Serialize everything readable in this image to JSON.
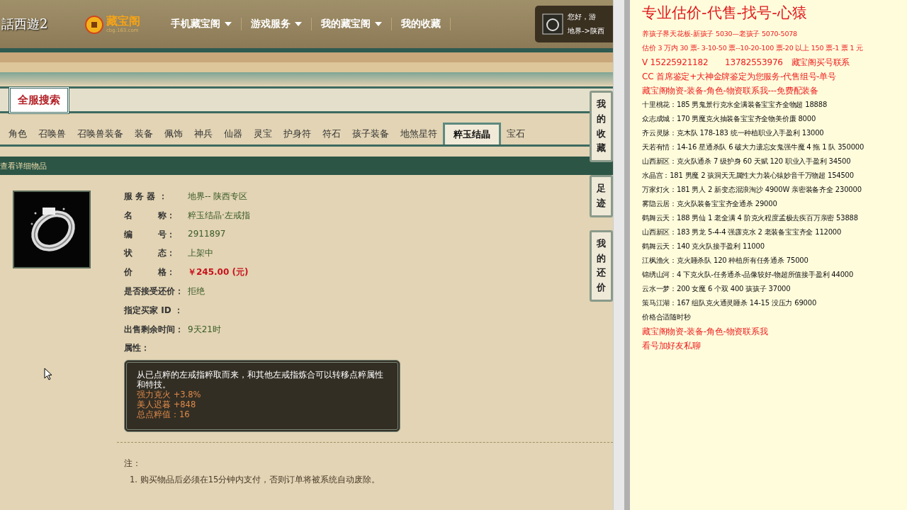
{
  "header": {
    "logo": "話西遊2",
    "brand": "藏宝阁",
    "brand_sub": "cbg.163.com",
    "nav": [
      {
        "label": "手机藏宝阁",
        "dropdown": true
      },
      {
        "label": "游戏服务",
        "dropdown": true
      },
      {
        "label": "我的藏宝阁",
        "dropdown": true
      },
      {
        "label": "我的收藏",
        "dropdown": false
      }
    ],
    "user": {
      "greeting": "您好，游",
      "server": "地界->陕西"
    }
  },
  "search_banner": "全服搜索",
  "tabs": [
    {
      "label": "角色",
      "selected": false
    },
    {
      "label": "召唤兽",
      "selected": false
    },
    {
      "label": "召唤兽装备",
      "selected": false
    },
    {
      "label": "装备",
      "selected": false
    },
    {
      "label": "佩饰",
      "selected": false
    },
    {
      "label": "神兵",
      "selected": false
    },
    {
      "label": "仙器",
      "selected": false
    },
    {
      "label": "灵宝",
      "selected": false
    },
    {
      "label": "护身符",
      "selected": false
    },
    {
      "label": "符石",
      "selected": false
    },
    {
      "label": "孩子装备",
      "selected": false
    },
    {
      "label": "地煞星符",
      "selected": false
    },
    {
      "label": "粹玉结晶",
      "selected": true
    },
    {
      "label": "宝石",
      "selected": false
    }
  ],
  "section_title": "查看详细物品",
  "item": {
    "fields": [
      {
        "label": "服 务 器 ：",
        "value": "地界-- 陕西专区",
        "kind": "normal"
      },
      {
        "label": "名　　　称：",
        "value": "粹玉结晶·左戒指",
        "kind": "normal"
      },
      {
        "label": "编　　　号：",
        "value": "2911897",
        "kind": "normal"
      },
      {
        "label": "状　　　态：",
        "value": "上架中",
        "kind": "normal"
      },
      {
        "label": "价　　　格：",
        "value": "￥245.00 (元)",
        "kind": "price"
      },
      {
        "label": "是否接受还价：",
        "value": "拒绝",
        "kind": "normal"
      },
      {
        "label": "指定买家 ID ：",
        "kind": "normal"
      },
      {
        "label": "出售剩余时间：",
        "value": "9天21时",
        "kind": "normal"
      },
      {
        "label": "属性：",
        "kind": "normal"
      }
    ],
    "description": "从已点粹的左戒指粹取而来，和其他左戒指炼合可以转移点粹属性和特技。",
    "attributes": [
      "强力克火 +3.8%",
      "美人迟暮 +848",
      "总点粹值：16"
    ]
  },
  "notes": {
    "title": "注：",
    "items": [
      "1. 购买物品后必须在15分钟内支付，否则订单将被系统自动废除。"
    ]
  },
  "side_tabs": [
    "我的收藏",
    "足迹",
    "我的还价"
  ],
  "document": {
    "title": "专业估价-代售-找号-心猿",
    "lines": [
      {
        "text": "养孩子界天花板-新孩子 5030—老孩子 5070-5078",
        "kind": "red-small"
      },
      {
        "text": "估价 3 万内 30 票- 3-10-50 票--10-20-100 票-20 以上 150 票-1 票 1 元",
        "kind": "red-small"
      },
      {
        "text": "V 15225921182　　13782553976　藏宝阁买号联系",
        "kind": "red"
      },
      {
        "text": "CC 首席鉴定+大神金牌鉴定为您服务-代售组号-单号",
        "kind": "red"
      },
      {
        "text": "藏宝阁物资-装备-角色-物资联系我---免费配装备",
        "kind": "red"
      },
      {
        "text": "十里桃花：185 男鬼景行克水全满装备宝宝齐全物超 18888",
        "kind": "black"
      },
      {
        "text": "众志成城：170 男魔克火抽装备宝宝齐全物美价廉 8000",
        "kind": "black"
      },
      {
        "text": "齐云灵脉：克木队 178-183 统一种植职业入手盈利 13000",
        "kind": "black"
      },
      {
        "text": "天若有情：14-16 星通杀队 6 破大力遗忘女鬼强牛魔 4 拖 1 队 350000",
        "kind": "black"
      },
      {
        "text": "山西新区：克火队通杀 7 级护身 60 天赋 120 职业入手盈利 34500",
        "kind": "black"
      },
      {
        "text": "水晶宫：181 男魔 2 孩洞天无属性大力装心猿妙音千万物超 154500",
        "kind": "black"
      },
      {
        "text": "万家灯火：181 男人 2 新变态混浪淘沙 4900W 亲密装备齐全 230000",
        "kind": "black"
      },
      {
        "text": "雾隐云居：克火队装备宝宝齐全通杀 29000",
        "kind": "black"
      },
      {
        "text": "鹤舞云天：188 男仙 1 老全满 4 阶克火程度孟极去疾百万亲密 53888",
        "kind": "black"
      },
      {
        "text": "山西新区：183 男龙 5-4-4 强霹克水 2 老装备宝宝齐全 112000",
        "kind": "black"
      },
      {
        "text": "鹤舞云天：140 克火队接手盈利 11000",
        "kind": "black"
      },
      {
        "text": "江枫渔火：克火睡杀队 120 种植所有任务通杀 75000",
        "kind": "black"
      },
      {
        "text": "锦绣山河：4 下克火队-任务通杀-品像较好-物超所值接手盈利 44000",
        "kind": "black"
      },
      {
        "text": "云水一梦：200 女魔 6 个双 400 孩孩子 37000",
        "kind": "black"
      },
      {
        "text": "策马江湖：167 组队克火通灵睡杀 14-15 没压力 69000",
        "kind": "black"
      },
      {
        "text": "价格合适随时秒",
        "kind": "black"
      },
      {
        "text": "藏宝阁物资-装备-角色-物资联系我",
        "kind": "red"
      },
      {
        "text": "看号加好友私聊",
        "kind": "red"
      }
    ]
  }
}
